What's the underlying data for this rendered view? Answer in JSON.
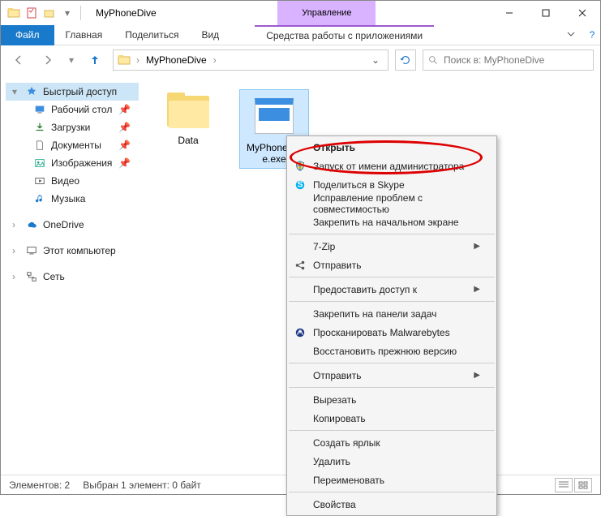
{
  "window": {
    "title": "MyPhoneDive",
    "contextual_tab_title": "Управление",
    "contextual_tab_sub": "Средства работы с приложениями"
  },
  "ribbon": {
    "file": "Файл",
    "tabs": [
      "Главная",
      "Поделиться",
      "Вид"
    ]
  },
  "address": {
    "crumbs": [
      "MyPhoneDive"
    ],
    "search_placeholder": "Поиск в: MyPhoneDive"
  },
  "sidebar": {
    "quick_access": "Быстрый доступ",
    "items": [
      {
        "label": "Рабочий стол",
        "pin": true
      },
      {
        "label": "Загрузки",
        "pin": true
      },
      {
        "label": "Документы",
        "pin": true
      },
      {
        "label": "Изображения",
        "pin": true
      },
      {
        "label": "Видео",
        "pin": false
      },
      {
        "label": "Музыка",
        "pin": false
      }
    ],
    "onedrive": "OneDrive",
    "this_pc": "Этот компьютер",
    "network": "Сеть"
  },
  "files": [
    {
      "name": "Data",
      "type": "folder"
    },
    {
      "name": "MyPhoneDive.exe",
      "type": "exe",
      "selected": true
    }
  ],
  "context_menu": {
    "groups": [
      [
        {
          "label": "Открыть",
          "bold": true
        },
        {
          "label": "Запуск от имени администратора",
          "icon": "shield"
        },
        {
          "label": "Поделиться в Skype",
          "icon": "skype"
        },
        {
          "label": "Исправление проблем с совместимостью"
        },
        {
          "label": "Закрепить на начальном экране"
        }
      ],
      [
        {
          "label": "7-Zip",
          "submenu": true
        },
        {
          "label": "Отправить",
          "icon": "share"
        }
      ],
      [
        {
          "label": "Предоставить доступ к",
          "submenu": true
        }
      ],
      [
        {
          "label": "Закрепить на панели задач"
        },
        {
          "label": "Просканировать Malwarebytes",
          "icon": "malwarebytes"
        },
        {
          "label": "Восстановить прежнюю версию"
        }
      ],
      [
        {
          "label": "Отправить",
          "submenu": true
        }
      ],
      [
        {
          "label": "Вырезать"
        },
        {
          "label": "Копировать"
        }
      ],
      [
        {
          "label": "Создать ярлык"
        },
        {
          "label": "Удалить"
        },
        {
          "label": "Переименовать"
        }
      ],
      [
        {
          "label": "Свойства"
        }
      ]
    ]
  },
  "statusbar": {
    "count": "Элементов: 2",
    "selection": "Выбран 1 элемент: 0 байт"
  },
  "colors": {
    "accent": "#1979ca",
    "highlight": "#d00",
    "selection_bg": "#cde8ff"
  }
}
